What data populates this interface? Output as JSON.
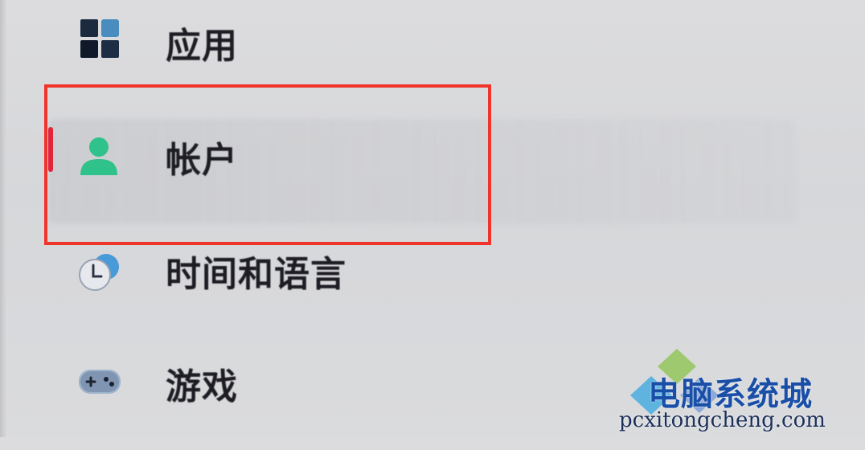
{
  "nav": {
    "items": [
      {
        "id": "apps",
        "label": "应用",
        "icon": "apps-icon"
      },
      {
        "id": "accounts",
        "label": "帐户",
        "icon": "account-person-icon",
        "selected": true
      },
      {
        "id": "time_language",
        "label": "时间和语言",
        "icon": "time-language-icon"
      },
      {
        "id": "gaming",
        "label": "游戏",
        "icon": "gamepad-icon"
      }
    ]
  },
  "watermark": {
    "brand": "电脑系统城",
    "url": "pcxitongcheng.com"
  },
  "colors": {
    "selection_indicator": "#e3243a",
    "highlight_box": "#f0342c",
    "account_icon": "#2fc28a",
    "watermark_text": "#1a4fa8"
  }
}
